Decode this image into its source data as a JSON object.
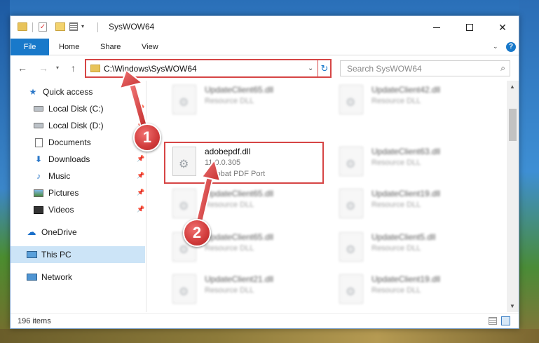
{
  "window": {
    "title": "SysWOW64",
    "controls": {
      "minimize": "",
      "maximize": "",
      "close": "✕"
    }
  },
  "ribbon": {
    "tabs": [
      {
        "label": "File"
      },
      {
        "label": "Home"
      },
      {
        "label": "Share"
      },
      {
        "label": "View"
      }
    ],
    "help": "?"
  },
  "navigation": {
    "address": "C:\\Windows\\SysWOW64",
    "search_placeholder": "Search SysWOW64"
  },
  "sidebar": {
    "items": [
      {
        "label": "Quick access"
      },
      {
        "label": "Local Disk (C:)"
      },
      {
        "label": "Local Disk (D:)"
      },
      {
        "label": "Documents"
      },
      {
        "label": "Downloads"
      },
      {
        "label": "Music"
      },
      {
        "label": "Pictures"
      },
      {
        "label": "Videos"
      },
      {
        "label": "OneDrive"
      },
      {
        "label": "This PC"
      },
      {
        "label": "Network"
      }
    ]
  },
  "files": {
    "highlighted": {
      "name": "adobepdf.dll",
      "version": "11.0.0.305",
      "description": "Acrobat  PDF Port"
    },
    "blurred": [
      {
        "name": "UpdateClient65.dll",
        "type": "Resource DLL"
      },
      {
        "name": "UpdateClient42.dll",
        "type": "Resource DLL"
      },
      {
        "name": "UpdateClient63.dll",
        "type": "Resource DLL"
      },
      {
        "name": "UpdateClient65.dll",
        "type": "Resource DLL"
      },
      {
        "name": "UpdateClient19.dll",
        "type": "Resource DLL"
      },
      {
        "name": "UpdateClient65.dll",
        "type": "Resource DLL"
      },
      {
        "name": "UpdateClient5.dll",
        "type": "Resource DLL"
      },
      {
        "name": "UpdateClient21.dll",
        "type": "Resource DLL"
      },
      {
        "name": "UpdateClient19.dll",
        "type": "Resource DLL"
      }
    ]
  },
  "status": {
    "count": "196 items"
  },
  "callouts": {
    "first": "1",
    "second": "2"
  },
  "colors": {
    "accent": "#1979ca",
    "highlight": "#d64545",
    "selected": "#cce4f7"
  }
}
